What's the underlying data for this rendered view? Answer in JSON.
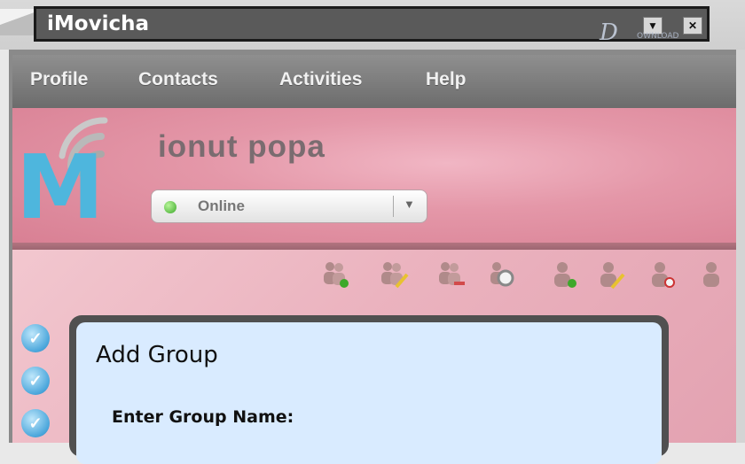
{
  "window": {
    "title": "iMovicha",
    "minimize_glyph": "▼",
    "close_glyph": "✕"
  },
  "watermark": {
    "letter": "D",
    "text": "OWNLOAD"
  },
  "menu": {
    "items": [
      {
        "label": "Profile"
      },
      {
        "label": "Contacts"
      },
      {
        "label": "Activities"
      },
      {
        "label": "Help"
      }
    ]
  },
  "profile": {
    "logo_letter": "M",
    "user_name": "ionut popa",
    "status": {
      "label": "Online",
      "dropdown_glyph": "▼",
      "color": "#3da82a"
    }
  },
  "toolbar": {
    "icons": [
      {
        "name": "add-group-icon"
      },
      {
        "name": "edit-group-icon"
      },
      {
        "name": "remove-group-icon"
      },
      {
        "name": "search-group-icon"
      },
      {
        "name": "add-contact-icon"
      },
      {
        "name": "edit-contact-icon"
      },
      {
        "name": "remove-contact-icon"
      },
      {
        "name": "contact-icon"
      }
    ]
  },
  "sidebar": {
    "check_glyph": "✓"
  },
  "dialog": {
    "title": "Add Group",
    "field_label": "Enter Group Name:"
  },
  "colors": {
    "accent_blue": "#4eb6dd",
    "header_pink": "#e497a8",
    "dialog_bg": "#d9ebff"
  }
}
